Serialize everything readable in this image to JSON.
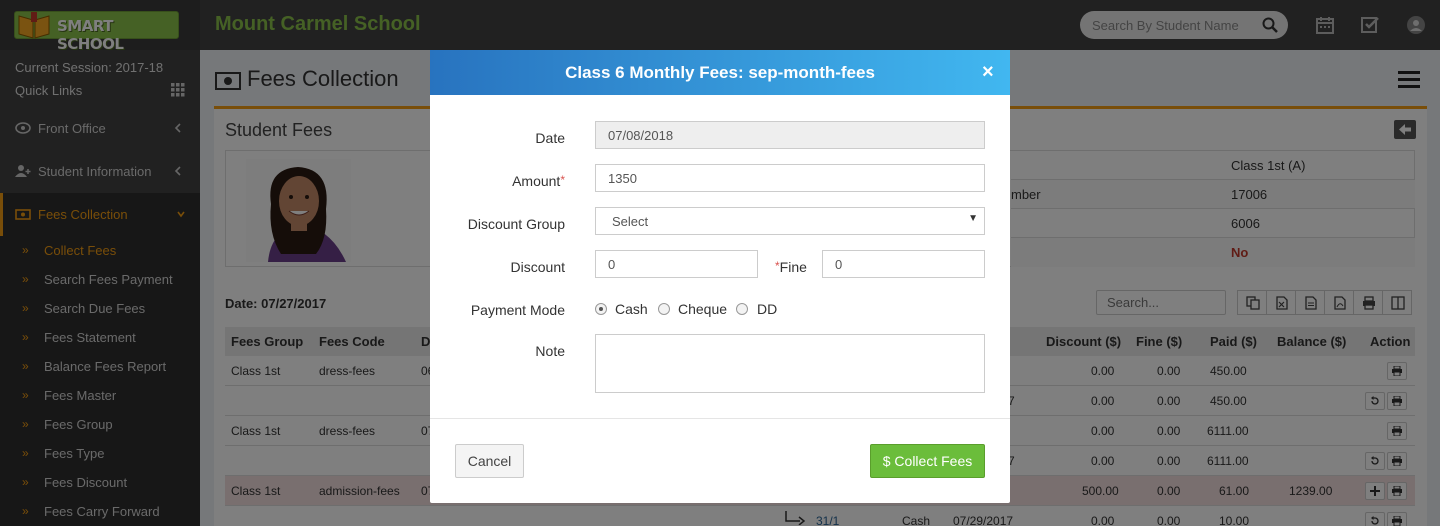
{
  "header": {
    "logo_text": "SMART SCHOOL",
    "school_name": "Mount Carmel School",
    "search_placeholder": "Search By Student Name"
  },
  "sidebar": {
    "session": "Current Session: 2017-18",
    "quick_links": "Quick Links",
    "menu": [
      {
        "label": "Front Office"
      },
      {
        "label": "Student Information"
      },
      {
        "label": "Fees Collection"
      }
    ],
    "sub_items": [
      {
        "label": "Collect Fees"
      },
      {
        "label": "Search Fees Payment"
      },
      {
        "label": "Search Due Fees"
      },
      {
        "label": "Fees Statement"
      },
      {
        "label": "Balance Fees Report"
      },
      {
        "label": "Fees Master"
      },
      {
        "label": "Fees Group"
      },
      {
        "label": "Fees Type"
      },
      {
        "label": "Fees Discount"
      },
      {
        "label": "Fees Carry Forward"
      }
    ]
  },
  "page": {
    "title": "Fees Collection",
    "box_title": "Student Fees",
    "info": [
      {
        "label": "",
        "value": "Class 1st (A)"
      },
      {
        "label": "mber",
        "value": "17006"
      },
      {
        "label": "",
        "value": "6006"
      },
      {
        "label": "",
        "value": "No"
      }
    ],
    "date_label": "Date: 07/27/2017",
    "table_search_placeholder": "Search...",
    "columns": {
      "fees_group": "Fees Group",
      "fees_code": "Fees Code",
      "due": "D",
      "discount": "Discount ($)",
      "fine": "Fine ($)",
      "paid": "Paid ($)",
      "balance": "Balance ($)",
      "action": "Action"
    },
    "rows": [
      {
        "group": "Class 1st",
        "code": "dress-fees",
        "due": "06",
        "extra": "",
        "discount": "0.00",
        "fine": "0.00",
        "paid": "450.00",
        "balance": ""
      },
      {
        "group": "",
        "code": "",
        "due": "",
        "extra": "7",
        "discount": "0.00",
        "fine": "0.00",
        "paid": "450.00",
        "balance": ""
      },
      {
        "group": "Class 1st",
        "code": "dress-fees",
        "due": "07",
        "extra": "",
        "discount": "0.00",
        "fine": "0.00",
        "paid": "6111.00",
        "balance": ""
      },
      {
        "group": "",
        "code": "",
        "due": "",
        "extra": "7",
        "discount": "0.00",
        "fine": "0.00",
        "paid": "6111.00",
        "balance": ""
      },
      {
        "group": "Class 1st",
        "code": "admission-fees",
        "due": "07",
        "extra": "",
        "discount": "500.00",
        "fine": "0.00",
        "paid": "61.00",
        "balance": "1239.00"
      },
      {
        "group": "",
        "code": "",
        "due": "",
        "extra": "",
        "payment_id": "31/1",
        "mode": "Cash",
        "date": "07/29/2017",
        "discount": "0.00",
        "fine": "0.00",
        "paid": "10.00",
        "balance": ""
      }
    ]
  },
  "modal": {
    "title": "Class 6 Monthly Fees: sep-month-fees",
    "close": "×",
    "date_label": "Date",
    "date_value": "07/08/2018",
    "amount_label": "Amount",
    "amount_value": "1350",
    "required_mark": "*",
    "discount_group_label": "Discount Group",
    "discount_group_value": "Select",
    "discount_label": "Discount",
    "discount_value": "0",
    "fine_label": "Fine",
    "fine_value": "0",
    "payment_mode_label": "Payment Mode",
    "payment_modes": [
      "Cash",
      "Cheque",
      "DD"
    ],
    "payment_mode_selected": "Cash",
    "note_label": "Note",
    "note_value": "",
    "cancel_label": "Cancel",
    "collect_label": "$ Collect Fees"
  }
}
